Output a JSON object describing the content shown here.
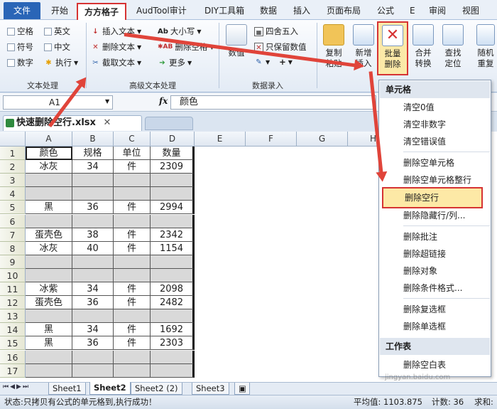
{
  "ribbon_tabs": [
    "开始",
    "方方格子",
    "AudTool审计",
    "DIY工具箱",
    "数据",
    "插入",
    "页面布局",
    "公式",
    "E",
    "审阅",
    "视图"
  ],
  "file_tab": "文件",
  "text_group": {
    "checks": [
      "空格",
      "英文",
      "符号",
      "中文",
      "数字"
    ],
    "exec": "执行",
    "label": "文本处理"
  },
  "adv_group": {
    "insert": "插入文本",
    "delete": "删除文本",
    "extract": "截取文本",
    "case": "大小写",
    "del_space": "删除空格",
    "more": "更多",
    "label": "高级文本处理"
  },
  "num_group": {
    "value": "数值",
    "round": "四舍五入",
    "keep": "只保留数值",
    "label": "数据录入"
  },
  "big_buttons": {
    "paste": "复制\n粘贴",
    "newins": "新增\n插入",
    "batchdel": "批量\n删除",
    "merge": "合并\n转换",
    "findpos": "查找\n定位",
    "random": "随机\n重复"
  },
  "namebox": "A1",
  "fx": "fx",
  "formula_value": "颜色",
  "workbook_title": "快速删除空行.xlsx",
  "columns": [
    "A",
    "B",
    "C",
    "D",
    "E",
    "F",
    "G",
    "H"
  ],
  "rows": [
    "1",
    "2",
    "3",
    "4",
    "5",
    "6",
    "7",
    "8",
    "9",
    "10",
    "11",
    "12",
    "13",
    "14",
    "15",
    "16",
    "17"
  ],
  "cells": [
    [
      "颜色",
      "规格",
      "单位",
      "数量"
    ],
    [
      "冰灰",
      "34",
      "件",
      "2309"
    ],
    [
      "",
      "",
      "",
      ""
    ],
    [
      "",
      "",
      "",
      ""
    ],
    [
      "黑",
      "36",
      "件",
      "2994"
    ],
    [
      "",
      "",
      "",
      ""
    ],
    [
      "蛋壳色",
      "38",
      "件",
      "2342"
    ],
    [
      "冰灰",
      "40",
      "件",
      "1154"
    ],
    [
      "",
      "",
      "",
      ""
    ],
    [
      "",
      "",
      "",
      ""
    ],
    [
      "冰紫",
      "34",
      "件",
      "2098"
    ],
    [
      "蛋壳色",
      "36",
      "件",
      "2482"
    ],
    [
      "",
      "",
      "",
      ""
    ],
    [
      "黑",
      "34",
      "件",
      "1692"
    ],
    [
      "黑",
      "36",
      "件",
      "2303"
    ],
    [
      "",
      "",
      "",
      ""
    ],
    [
      "",
      "",
      "",
      ""
    ]
  ],
  "sheets": [
    "Sheet1",
    "Sheet2",
    "Sheet2 (2)",
    "Sheet3"
  ],
  "status": {
    "left": "状态:只拷贝有公式的单元格到,执行成功！",
    "avg": "平均值: 1103.875",
    "count": "计数: 36",
    "sum": "求和:"
  },
  "menu": {
    "header1": "单元格",
    "items": [
      "清空0值",
      "清空非数字",
      "清空错误值",
      "删除空单元格",
      "删除空单元格整行",
      "删除空行",
      "删除隐藏行/列...",
      "删除批注",
      "删除超链接",
      "删除对象",
      "删除条件格式...",
      "删除复选框",
      "删除单选框"
    ],
    "header2": "工作表",
    "last": "删除空白表"
  },
  "watermark": "jingyan.baidu.com",
  "accent": "#d63333"
}
